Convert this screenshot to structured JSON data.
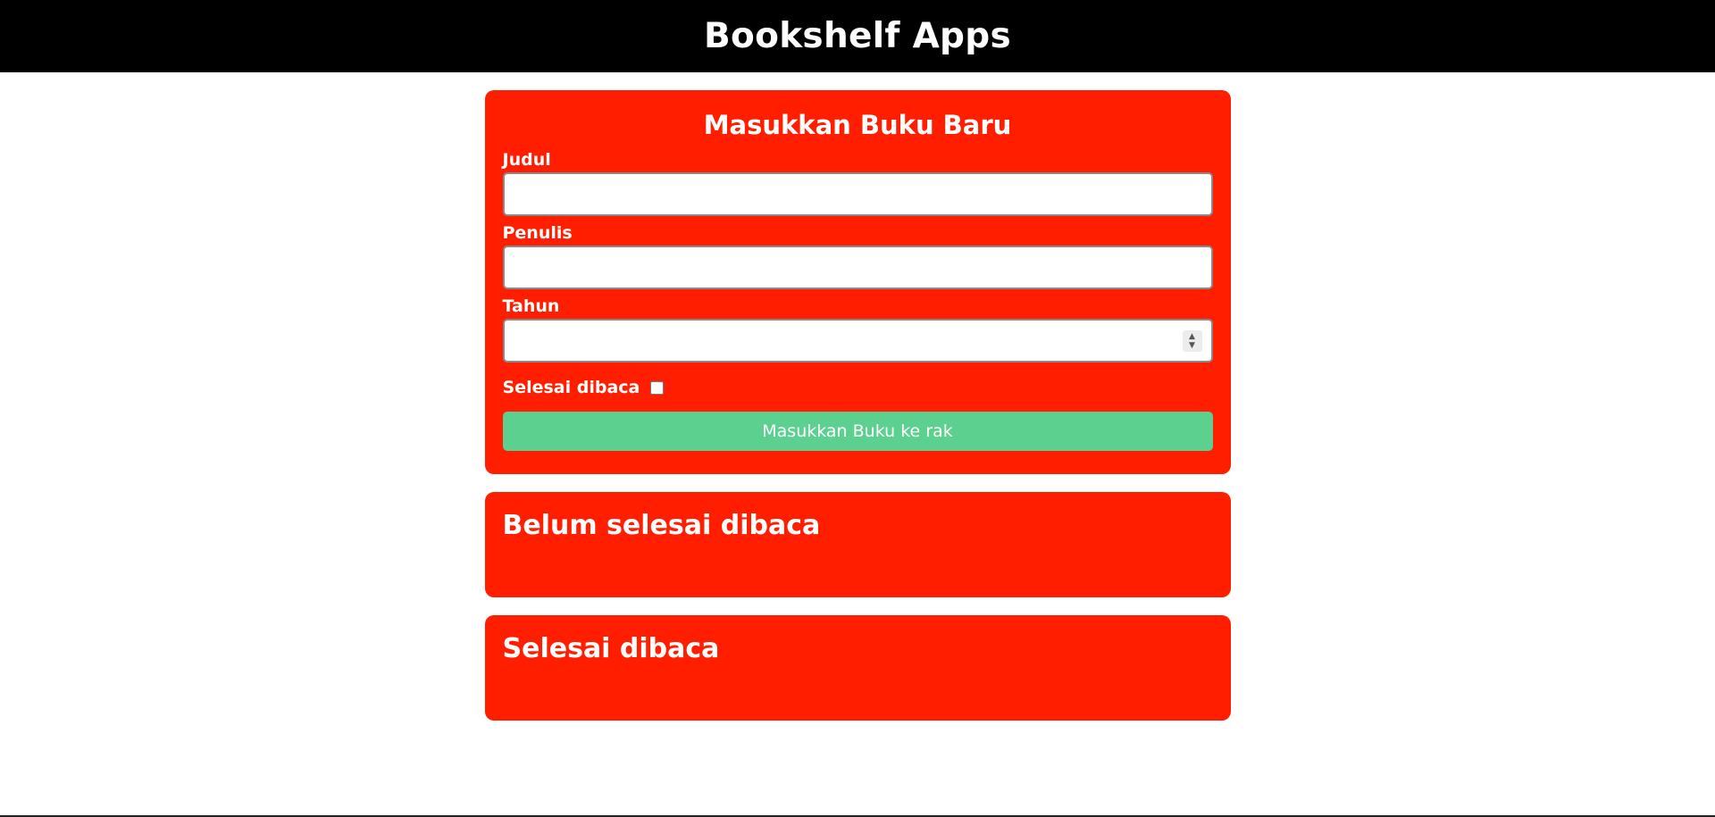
{
  "header": {
    "title": "Bookshelf Apps"
  },
  "input_section": {
    "title": "Masukkan Buku Baru",
    "fields": {
      "title_label": "Judul",
      "author_label": "Penulis",
      "year_label": "Tahun"
    },
    "completed_label": "Selesai dibaca",
    "submit_label": "Masukkan Buku ke rak"
  },
  "shelves": {
    "incomplete_title": "Belum selesai dibaca",
    "complete_title": "Selesai dibaca"
  },
  "colors": {
    "header_bg": "#000000",
    "section_bg": "#ff1e00",
    "button_bg": "#5bd08f"
  }
}
